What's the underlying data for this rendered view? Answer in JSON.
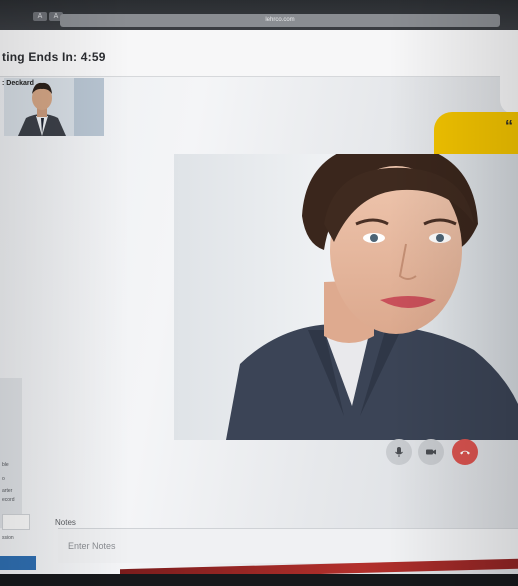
{
  "browser": {
    "tab_buttons": [
      "A",
      "A"
    ],
    "address": "lehrco.com"
  },
  "header": {
    "timer_text": "ting Ends In: 4:59"
  },
  "participant": {
    "name": ": Deckard"
  },
  "quote": {
    "mark": "“"
  },
  "side_panel": {
    "lines": [
      "ble",
      "o",
      "arter",
      "ecord",
      "ssion"
    ]
  },
  "controls": {
    "mic": "microphone-icon",
    "camera": "camera-icon",
    "end_call": "phone-end-icon"
  },
  "notes": {
    "label": "Notes",
    "placeholder": "Enter Notes"
  },
  "colors": {
    "accent_yellow": "#f2c300",
    "end_call_red": "#d9534f",
    "side_button_blue": "#2f6fb2"
  }
}
